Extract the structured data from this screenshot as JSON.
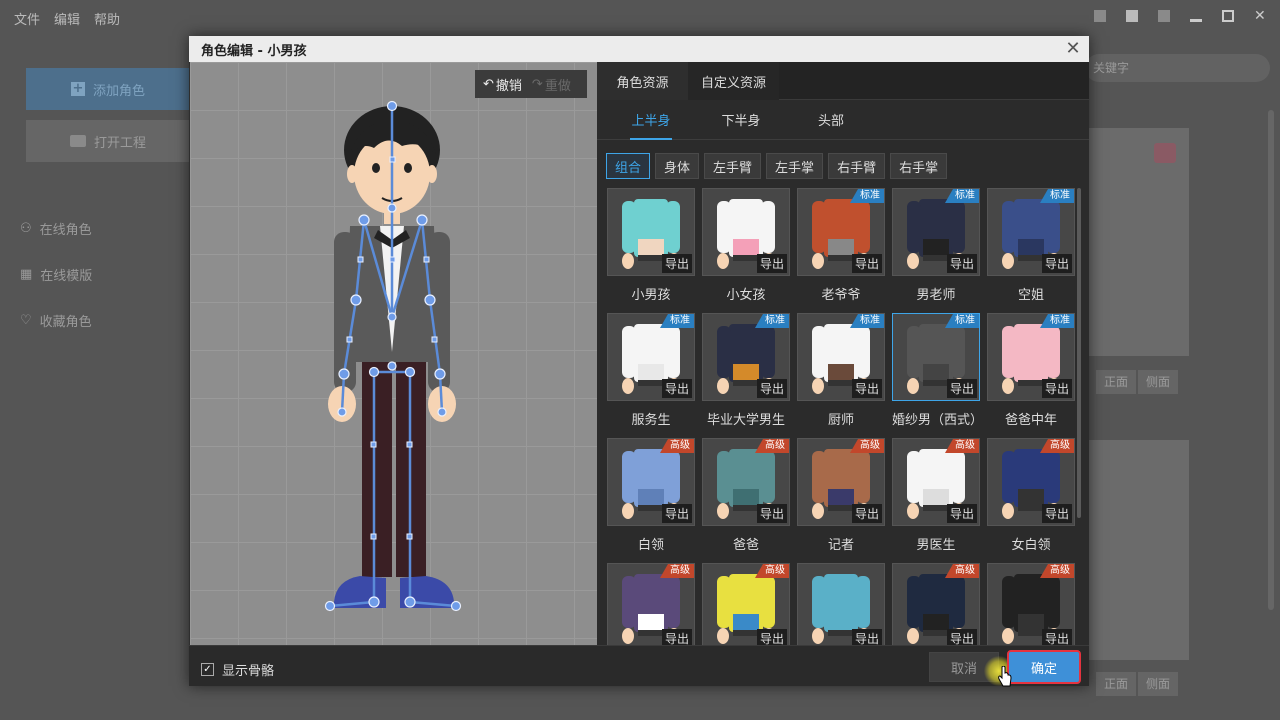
{
  "menu": [
    "文件",
    "编辑",
    "帮助"
  ],
  "sidebar": {
    "add_label": "添加角色",
    "open_label": "打开工程",
    "nav": [
      {
        "label": "在线角色",
        "icon": "user-icon"
      },
      {
        "label": "在线模版",
        "icon": "grid-icon"
      },
      {
        "label": "收藏角色",
        "icon": "heart-icon"
      }
    ]
  },
  "bg": {
    "search_placeholder": "关键字",
    "front_label": "正面",
    "side_label": "侧面"
  },
  "dialog": {
    "title": "角色编辑 - 小男孩",
    "undo_label": "撤销",
    "redo_label": "重做",
    "tabs": [
      "角色资源",
      "自定义资源"
    ],
    "subtabs": [
      "上半身",
      "下半身",
      "头部"
    ],
    "categories": [
      "组合",
      "身体",
      "左手臂",
      "左手掌",
      "右手臂",
      "右手掌"
    ],
    "export_label": "导出",
    "badge_std": "标准",
    "badge_pro": "高级",
    "items": [
      {
        "label": "小男孩",
        "badge": ""
      },
      {
        "label": "小女孩",
        "badge": ""
      },
      {
        "label": "老爷爷",
        "badge": "std"
      },
      {
        "label": "男老师",
        "badge": "std"
      },
      {
        "label": "空姐",
        "badge": "std"
      },
      {
        "label": "服务生",
        "badge": "std"
      },
      {
        "label": "毕业大学男生",
        "badge": "std"
      },
      {
        "label": "厨师",
        "badge": "std"
      },
      {
        "label": "婚纱男（西式）",
        "badge": "std"
      },
      {
        "label": "爸爸中年",
        "badge": "std"
      },
      {
        "label": "白领",
        "badge": "pro"
      },
      {
        "label": "爸爸",
        "badge": "pro"
      },
      {
        "label": "记者",
        "badge": "pro"
      },
      {
        "label": "男医生",
        "badge": "pro"
      },
      {
        "label": "女白领",
        "badge": "pro"
      },
      {
        "label": "",
        "badge": "pro"
      },
      {
        "label": "",
        "badge": "pro"
      },
      {
        "label": "",
        "badge": ""
      },
      {
        "label": "",
        "badge": "pro"
      },
      {
        "label": "",
        "badge": "pro"
      }
    ],
    "show_skeleton_label": "显示骨骼",
    "cancel_label": "取消",
    "ok_label": "确定"
  }
}
